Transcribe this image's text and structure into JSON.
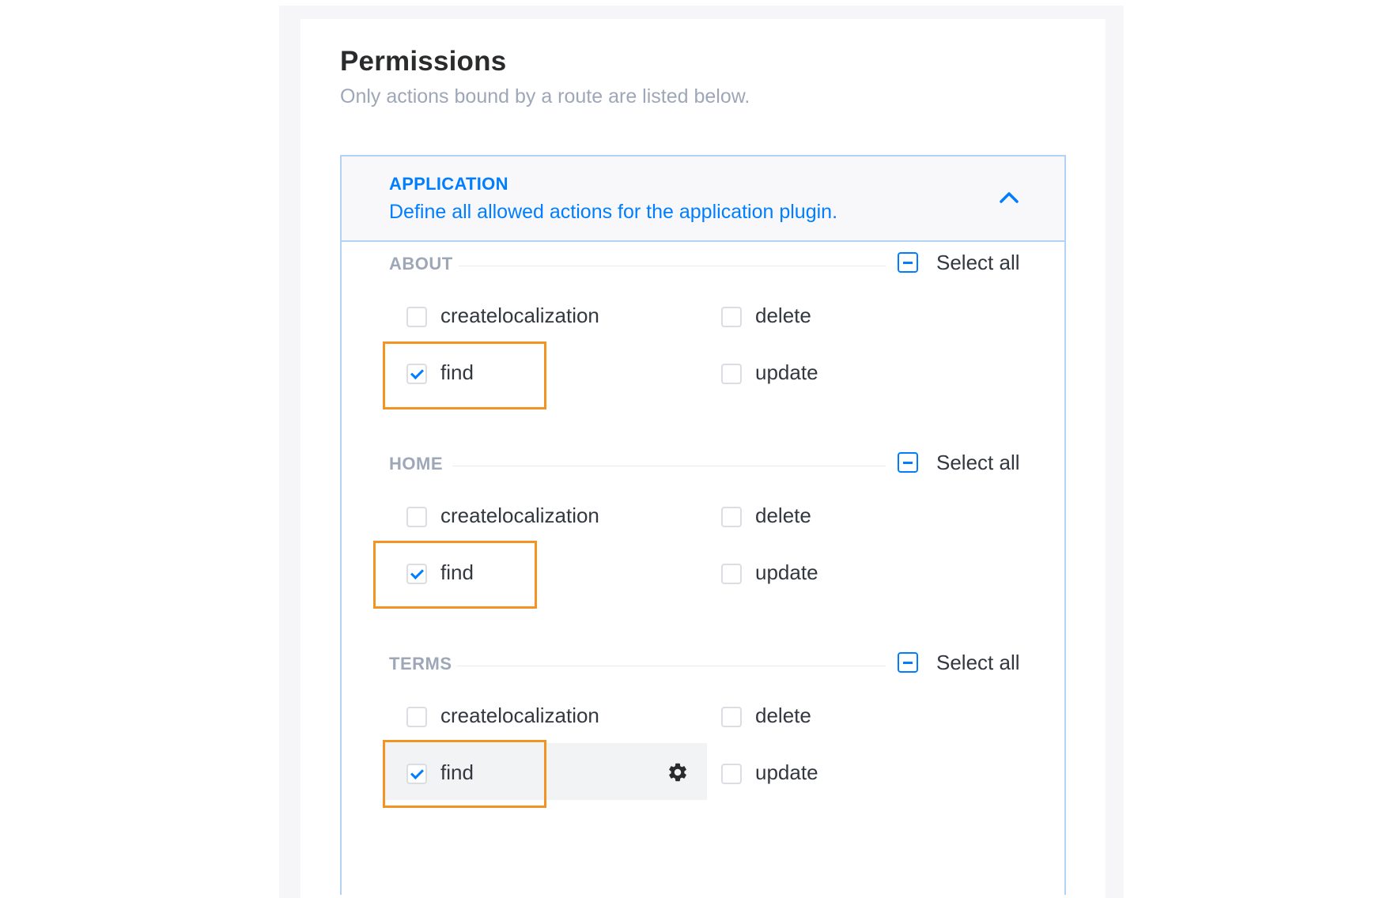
{
  "page": {
    "title": "Permissions",
    "subtitle": "Only actions bound by a route are listed below."
  },
  "plugin": {
    "label": "APPLICATION",
    "description": "Define all allowed actions for the application plugin.",
    "expanded": true
  },
  "sections": [
    {
      "name": "ABOUT",
      "select_all_label": "Select all",
      "select_all_state": "indeterminate",
      "actions": [
        {
          "label": "createlocalization",
          "checked": false
        },
        {
          "label": "delete",
          "checked": false
        },
        {
          "label": "find",
          "checked": true,
          "highlighted": true
        },
        {
          "label": "update",
          "checked": false
        }
      ]
    },
    {
      "name": "HOME",
      "select_all_label": "Select all",
      "select_all_state": "indeterminate",
      "actions": [
        {
          "label": "createlocalization",
          "checked": false
        },
        {
          "label": "delete",
          "checked": false
        },
        {
          "label": "find",
          "checked": true,
          "highlighted": true
        },
        {
          "label": "update",
          "checked": false
        }
      ]
    },
    {
      "name": "TERMS",
      "select_all_label": "Select all",
      "select_all_state": "indeterminate",
      "actions": [
        {
          "label": "createlocalization",
          "checked": false
        },
        {
          "label": "delete",
          "checked": false
        },
        {
          "label": "find",
          "checked": true,
          "highlighted": true,
          "hovered": true,
          "icon": "gear-icon"
        },
        {
          "label": "update",
          "checked": false
        }
      ]
    }
  ],
  "colors": {
    "accent": "#007eff",
    "highlight": "#f39324",
    "border": "#b3d3f5"
  }
}
